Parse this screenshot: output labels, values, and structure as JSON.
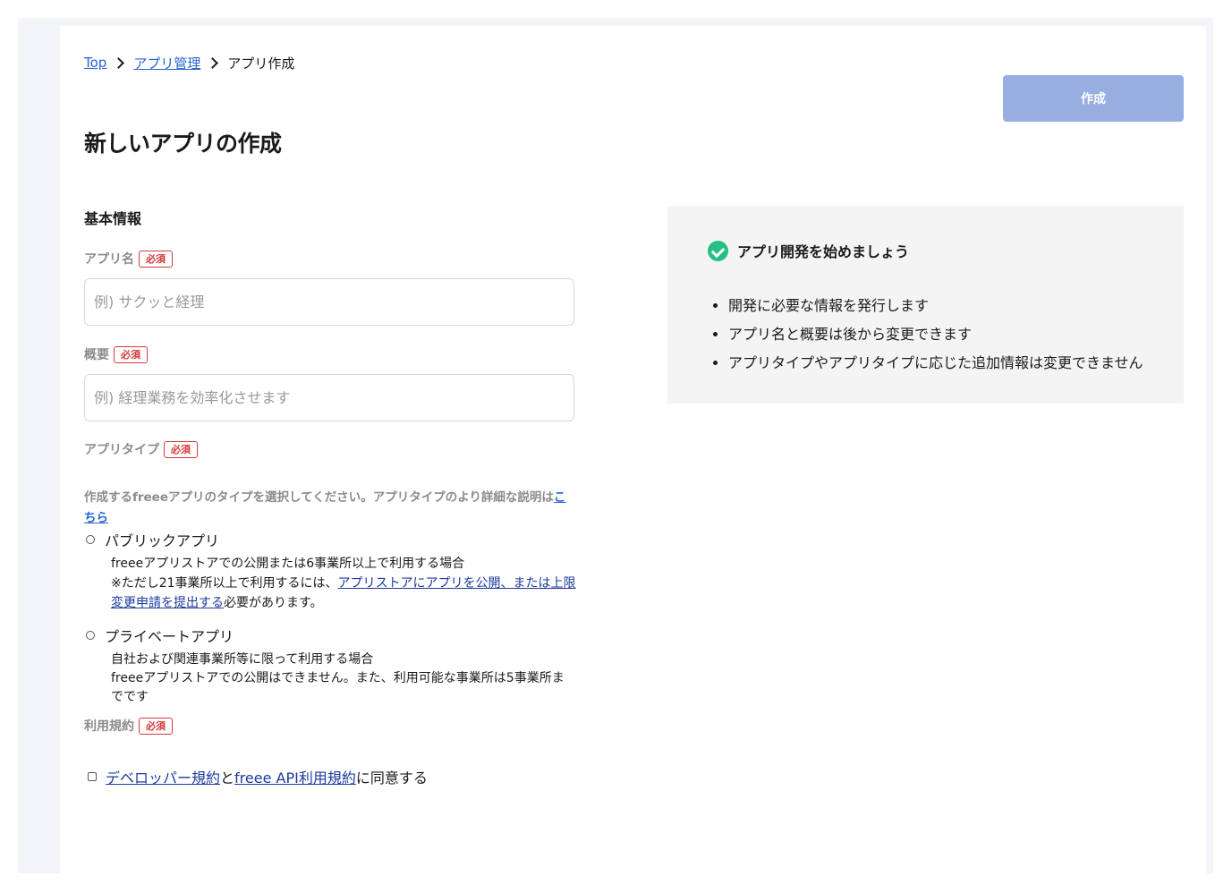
{
  "breadcrumb": {
    "top": "Top",
    "app_management": "アプリ管理",
    "current": "アプリ作成"
  },
  "header": {
    "title": "新しいアプリの作成",
    "create_button": "作成"
  },
  "form": {
    "section_title": "基本情報",
    "required_badge": "必須",
    "app_name": {
      "label": "アプリ名",
      "placeholder": "例) サクッと経理",
      "value": ""
    },
    "description": {
      "label": "概要",
      "placeholder": "例) 経理業務を効率化させます",
      "value": ""
    },
    "app_type": {
      "label": "アプリタイプ",
      "help_text": "作成するfreeeアプリのタイプを選択してください。アプリタイプのより詳細な説明は",
      "help_link": "こちら",
      "options": [
        {
          "label": "パブリックアプリ",
          "desc_line1": "freeeアプリストアでの公開または6事業所以上で利用する場合",
          "desc_line2_pre": "※ただし21事業所以上で利用するには、",
          "desc_link": "アプリストアにアプリを公開、または上限変更申請を提出する",
          "desc_line2_post": "必要があります。",
          "selected": false
        },
        {
          "label": "プライベートアプリ",
          "desc_line1": "自社および関連事業所等に限って利用する場合",
          "desc_line2": "freeeアプリストアでの公開はできません。また、利用可能な事業所は5事業所までです",
          "selected": false
        }
      ]
    },
    "terms": {
      "label": "利用規約",
      "link1": "デベロッパー規約",
      "conjunction": "と",
      "link2": "freee API利用規約",
      "suffix": "に同意する",
      "checked": false
    }
  },
  "info_panel": {
    "title": "アプリ開発を始めましょう",
    "items": [
      "開発に必要な情報を発行します",
      "アプリ名と概要は後から変更できます",
      "アプリタイプやアプリタイプに応じた追加情報は変更できません"
    ]
  },
  "colors": {
    "link": "#2864d2",
    "button_disabled": "#98aee0",
    "required": "#d33a3a",
    "success": "#24c083"
  }
}
